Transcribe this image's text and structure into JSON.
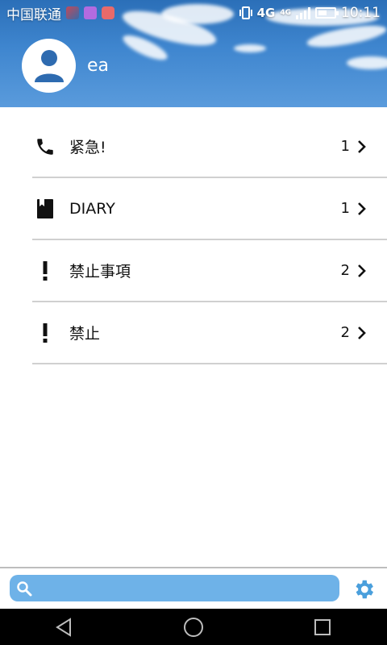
{
  "status_bar": {
    "carrier": "中国联通",
    "network": "4G",
    "network_small": "4G",
    "time": "10:11"
  },
  "profile": {
    "name": "ea",
    "avatar_icon": "person-icon"
  },
  "list": {
    "items": [
      {
        "icon": "phone-icon",
        "label": "紧急!",
        "count": "1"
      },
      {
        "icon": "book-icon",
        "label": "DIARY",
        "count": "1"
      },
      {
        "icon": "exclamation-icon",
        "label": "禁止事項",
        "count": "2"
      },
      {
        "icon": "exclamation-icon",
        "label": "禁止",
        "count": "2"
      }
    ]
  },
  "search": {
    "placeholder": "",
    "value": ""
  },
  "colors": {
    "header_sky": "#3f86cf",
    "search_bg": "#6eb2e8",
    "settings_icon": "#4a9fdc"
  }
}
